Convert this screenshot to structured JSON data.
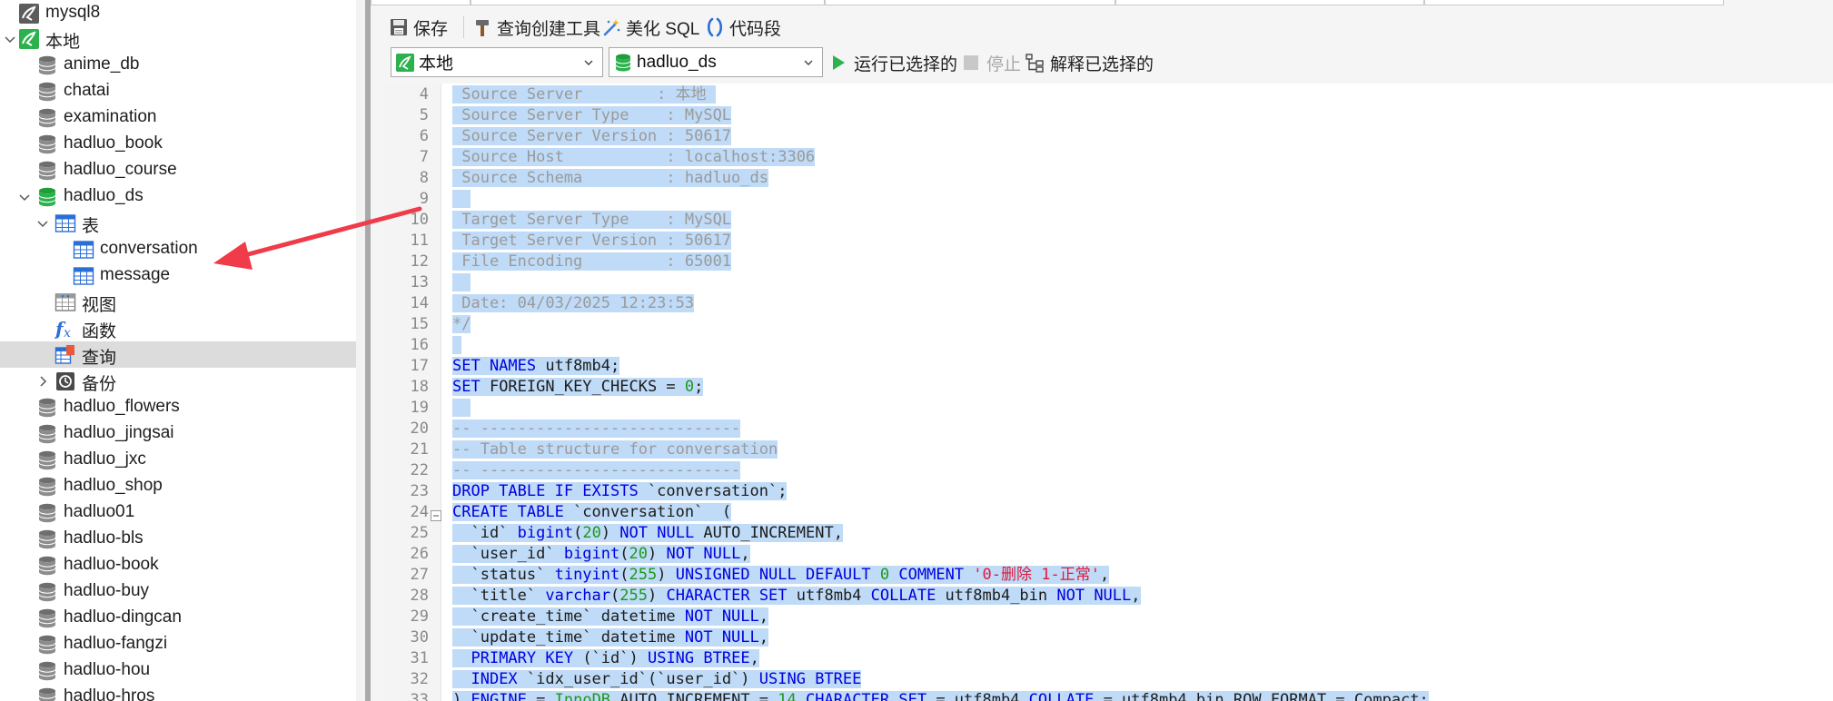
{
  "sidebar": {
    "items": [
      {
        "label": "mysql8",
        "icon": "mysql-connection-icon"
      },
      {
        "label": "本地",
        "icon": "mysql-connection-open-icon"
      },
      {
        "label": "anime_db",
        "icon": "database-icon"
      },
      {
        "label": "chatai",
        "icon": "database-icon"
      },
      {
        "label": "examination",
        "icon": "database-icon"
      },
      {
        "label": "hadluo_book",
        "icon": "database-icon"
      },
      {
        "label": "hadluo_course",
        "icon": "database-icon"
      },
      {
        "label": "hadluo_ds",
        "icon": "database-open-icon"
      },
      {
        "label": "表",
        "icon": "tables-folder-icon"
      },
      {
        "label": "conversation",
        "icon": "table-icon"
      },
      {
        "label": "message",
        "icon": "table-icon"
      },
      {
        "label": "视图",
        "icon": "views-icon"
      },
      {
        "label": "函数",
        "icon": "function-icon"
      },
      {
        "label": "查询",
        "icon": "query-icon"
      },
      {
        "label": "备份",
        "icon": "backup-icon"
      },
      {
        "label": "hadluo_flowers",
        "icon": "database-icon"
      },
      {
        "label": "hadluo_jingsai",
        "icon": "database-icon"
      },
      {
        "label": "hadluo_jxc",
        "icon": "database-icon"
      },
      {
        "label": "hadluo_shop",
        "icon": "database-icon"
      },
      {
        "label": "hadluo01",
        "icon": "database-icon"
      },
      {
        "label": "hadluo-bls",
        "icon": "database-icon"
      },
      {
        "label": "hadluo-book",
        "icon": "database-icon"
      },
      {
        "label": "hadluo-buy",
        "icon": "database-icon"
      },
      {
        "label": "hadluo-dingcan",
        "icon": "database-icon"
      },
      {
        "label": "hadluo-fangzi",
        "icon": "database-icon"
      },
      {
        "label": "hadluo-hou",
        "icon": "database-icon"
      },
      {
        "label": "hadluo-hros",
        "icon": "database-icon"
      }
    ]
  },
  "toolbar": {
    "save_label": "保存",
    "query_builder_label": "查询创建工具",
    "beautify_label": "美化 SQL",
    "snippet_label": "代码段"
  },
  "toolbar2": {
    "connection_value": "本地",
    "database_value": "hadluo_ds",
    "run_selected_label": "运行已选择的",
    "stop_label": "停止",
    "explain_selected_label": "解释已选择的"
  },
  "colors": {
    "selection": "#bfdbf7",
    "keyword": "#0000e0",
    "number": "#1a9a1a",
    "string": "#e0183a",
    "comment": "#9a9a9a",
    "arrow": "#ef3b4a"
  },
  "editor": {
    "lines": [
      {
        "n": "4",
        "fold": false,
        "tokens": [
          {
            "c": "t-comment",
            "t": " Source Server        : 本地 "
          }
        ]
      },
      {
        "n": "5",
        "fold": false,
        "tokens": [
          {
            "c": "t-comment",
            "t": " Source Server Type    : MySQL"
          }
        ]
      },
      {
        "n": "6",
        "fold": false,
        "tokens": [
          {
            "c": "t-comment",
            "t": " Source Server Version : 50617"
          }
        ]
      },
      {
        "n": "7",
        "fold": false,
        "tokens": [
          {
            "c": "t-comment",
            "t": " Source Host           : localhost:3306"
          }
        ]
      },
      {
        "n": "8",
        "fold": false,
        "tokens": [
          {
            "c": "t-comment",
            "t": " Source Schema         : hadluo_ds"
          }
        ]
      },
      {
        "n": "9",
        "fold": false,
        "tokens": [
          {
            "c": "t-comment",
            "t": "  "
          }
        ]
      },
      {
        "n": "10",
        "fold": false,
        "tokens": [
          {
            "c": "t-comment",
            "t": " Target Server Type    : MySQL"
          }
        ]
      },
      {
        "n": "11",
        "fold": false,
        "tokens": [
          {
            "c": "t-comment",
            "t": " Target Server Version : 50617"
          }
        ]
      },
      {
        "n": "12",
        "fold": false,
        "tokens": [
          {
            "c": "t-comment",
            "t": " File Encoding         : 65001"
          }
        ]
      },
      {
        "n": "13",
        "fold": false,
        "tokens": [
          {
            "c": "t-comment",
            "t": "  "
          }
        ]
      },
      {
        "n": "14",
        "fold": false,
        "tokens": [
          {
            "c": "t-comment",
            "t": " Date: 04/03/2025 12:23:53"
          }
        ]
      },
      {
        "n": "15",
        "fold": false,
        "tokens": [
          {
            "c": "t-comment",
            "t": "*/"
          }
        ]
      },
      {
        "n": "16",
        "fold": false,
        "tokens": [
          {
            "c": "t-plain",
            "t": " "
          }
        ]
      },
      {
        "n": "17",
        "fold": false,
        "tokens": [
          {
            "c": "t-kw",
            "t": "SET NAMES"
          },
          {
            "c": "t-plain",
            "t": " utf8mb4;"
          }
        ]
      },
      {
        "n": "18",
        "fold": false,
        "tokens": [
          {
            "c": "t-kw",
            "t": "SET"
          },
          {
            "c": "t-plain",
            "t": " FOREIGN_KEY_CHECKS = "
          },
          {
            "c": "t-num",
            "t": "0"
          },
          {
            "c": "t-plain",
            "t": ";"
          }
        ]
      },
      {
        "n": "19",
        "fold": false,
        "tokens": [
          {
            "c": "t-plain",
            "t": "  "
          }
        ]
      },
      {
        "n": "20",
        "fold": false,
        "tokens": [
          {
            "c": "t-comment",
            "t": "-- ----------------------------"
          }
        ]
      },
      {
        "n": "21",
        "fold": false,
        "tokens": [
          {
            "c": "t-comment",
            "t": "-- Table structure for conversation"
          }
        ]
      },
      {
        "n": "22",
        "fold": false,
        "tokens": [
          {
            "c": "t-comment",
            "t": "-- ----------------------------"
          }
        ]
      },
      {
        "n": "23",
        "fold": false,
        "tokens": [
          {
            "c": "t-kw",
            "t": "DROP TABLE IF EXISTS"
          },
          {
            "c": "t-plain",
            "t": " `conversation`;"
          }
        ]
      },
      {
        "n": "24",
        "fold": true,
        "tokens": [
          {
            "c": "t-kw",
            "t": "CREATE TABLE"
          },
          {
            "c": "t-plain",
            "t": " `conversation`  ("
          }
        ]
      },
      {
        "n": "25",
        "fold": false,
        "tokens": [
          {
            "c": "t-plain",
            "t": "  `id` "
          },
          {
            "c": "t-kw",
            "t": "bigint"
          },
          {
            "c": "t-plain",
            "t": "("
          },
          {
            "c": "t-num",
            "t": "20"
          },
          {
            "c": "t-plain",
            "t": ") "
          },
          {
            "c": "t-kw",
            "t": "NOT NULL"
          },
          {
            "c": "t-plain",
            "t": " AUTO_INCREMENT,"
          }
        ]
      },
      {
        "n": "26",
        "fold": false,
        "tokens": [
          {
            "c": "t-plain",
            "t": "  `user_id` "
          },
          {
            "c": "t-kw",
            "t": "bigint"
          },
          {
            "c": "t-plain",
            "t": "("
          },
          {
            "c": "t-num",
            "t": "20"
          },
          {
            "c": "t-plain",
            "t": ") "
          },
          {
            "c": "t-kw",
            "t": "NOT NULL"
          },
          {
            "c": "t-plain",
            "t": ","
          }
        ]
      },
      {
        "n": "27",
        "fold": false,
        "tokens": [
          {
            "c": "t-plain",
            "t": "  `status` "
          },
          {
            "c": "t-kw",
            "t": "tinyint"
          },
          {
            "c": "t-plain",
            "t": "("
          },
          {
            "c": "t-num",
            "t": "255"
          },
          {
            "c": "t-plain",
            "t": ") "
          },
          {
            "c": "t-kw",
            "t": "UNSIGNED NULL DEFAULT"
          },
          {
            "c": "t-plain",
            "t": " "
          },
          {
            "c": "t-num",
            "t": "0"
          },
          {
            "c": "t-plain",
            "t": " "
          },
          {
            "c": "t-kw",
            "t": "COMMENT"
          },
          {
            "c": "t-plain",
            "t": " "
          },
          {
            "c": "t-str",
            "t": "'0-删除 1-正常'"
          },
          {
            "c": "t-plain",
            "t": ","
          }
        ]
      },
      {
        "n": "28",
        "fold": false,
        "tokens": [
          {
            "c": "t-plain",
            "t": "  `title` "
          },
          {
            "c": "t-kw",
            "t": "varchar"
          },
          {
            "c": "t-plain",
            "t": "("
          },
          {
            "c": "t-num",
            "t": "255"
          },
          {
            "c": "t-plain",
            "t": ") "
          },
          {
            "c": "t-kw",
            "t": "CHARACTER SET"
          },
          {
            "c": "t-plain",
            "t": " utf8mb4 "
          },
          {
            "c": "t-kw",
            "t": "COLLATE"
          },
          {
            "c": "t-plain",
            "t": " utf8mb4_bin "
          },
          {
            "c": "t-kw",
            "t": "NOT NULL"
          },
          {
            "c": "t-plain",
            "t": ","
          }
        ]
      },
      {
        "n": "29",
        "fold": false,
        "tokens": [
          {
            "c": "t-plain",
            "t": "  `create_time` datetime "
          },
          {
            "c": "t-kw",
            "t": "NOT NULL"
          },
          {
            "c": "t-plain",
            "t": ","
          }
        ]
      },
      {
        "n": "30",
        "fold": false,
        "tokens": [
          {
            "c": "t-plain",
            "t": "  `update_time` datetime "
          },
          {
            "c": "t-kw",
            "t": "NOT NULL"
          },
          {
            "c": "t-plain",
            "t": ","
          }
        ]
      },
      {
        "n": "31",
        "fold": false,
        "tokens": [
          {
            "c": "t-plain",
            "t": "  "
          },
          {
            "c": "t-kw",
            "t": "PRIMARY KEY"
          },
          {
            "c": "t-plain",
            "t": " (`id`) "
          },
          {
            "c": "t-kw",
            "t": "USING BTREE"
          },
          {
            "c": "t-plain",
            "t": ","
          }
        ]
      },
      {
        "n": "32",
        "fold": false,
        "tokens": [
          {
            "c": "t-plain",
            "t": "  "
          },
          {
            "c": "t-kw",
            "t": "INDEX"
          },
          {
            "c": "t-plain",
            "t": " `idx_user_id`(`user_id`) "
          },
          {
            "c": "t-kw",
            "t": "USING BTREE"
          }
        ]
      },
      {
        "n": "33",
        "fold": false,
        "tokens": [
          {
            "c": "t-plain",
            "t": ") "
          },
          {
            "c": "t-kw",
            "t": "ENGINE"
          },
          {
            "c": "t-plain",
            "t": " = "
          },
          {
            "c": "t-num",
            "t": "InnoDB"
          },
          {
            "c": "t-plain",
            "t": " AUTO_INCREMENT = "
          },
          {
            "c": "t-num",
            "t": "14"
          },
          {
            "c": "t-plain",
            "t": " "
          },
          {
            "c": "t-kw",
            "t": "CHARACTER SET"
          },
          {
            "c": "t-plain",
            "t": " = utf8mb4 "
          },
          {
            "c": "t-kw",
            "t": "COLLATE"
          },
          {
            "c": "t-plain",
            "t": " = utf8mb4_bin ROW_FORMAT = Compact;"
          }
        ]
      }
    ]
  }
}
